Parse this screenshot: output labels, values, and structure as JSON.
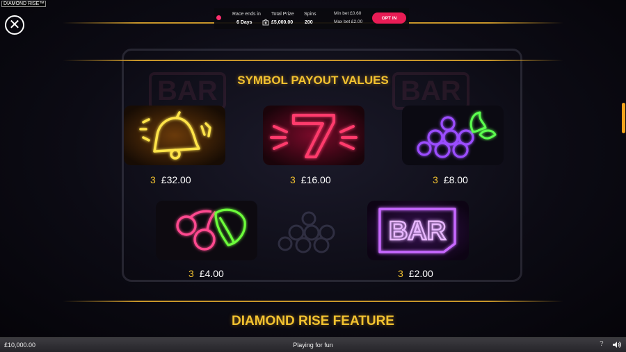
{
  "game_tag": "DIAMOND RISE™",
  "race": {
    "ends_label": "Race ends in",
    "ends_value": "6 Days",
    "prize_label": "Total Prize",
    "prize_value": "£5,000.00",
    "spins_label": "Spins",
    "spins_value": "200",
    "min_bet": "Min bet £0.60",
    "max_bet": "Max bet £2.00",
    "optin_label": "OPT IN"
  },
  "titles": {
    "payout": "SYMBOL PAYOUT VALUES",
    "feature": "DIAMOND RISE FEATURE"
  },
  "symbols": [
    {
      "name": "bell",
      "count": "3",
      "amount": "£32.00"
    },
    {
      "name": "seven",
      "count": "3",
      "amount": "£16.00"
    },
    {
      "name": "grapes",
      "count": "3",
      "amount": "£8.00"
    },
    {
      "name": "cherries",
      "count": "3",
      "amount": "£4.00"
    },
    {
      "name": "bar",
      "count": "3",
      "amount": "£2.00",
      "text": "BAR"
    }
  ],
  "bottom": {
    "balance": "£10,000.00",
    "mode": "Playing for fun",
    "help": "?"
  },
  "icons": {
    "close": "close-icon",
    "sound": "speaker-icon",
    "help": "help-icon"
  },
  "colors": {
    "gold": "#f2c230",
    "optin": "#e91c55"
  }
}
